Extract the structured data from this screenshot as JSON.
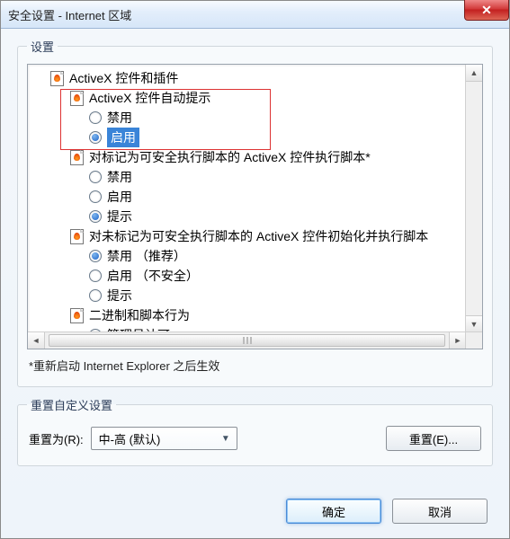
{
  "window": {
    "title": "安全设置 - Internet 区域"
  },
  "settings_group": {
    "legend": "设置"
  },
  "tree": {
    "root": {
      "label": "ActiveX 控件和插件"
    },
    "section1": {
      "label": "ActiveX 控件自动提示",
      "opt_disable": "禁用",
      "opt_enable": "启用"
    },
    "section2": {
      "label": "对标记为可安全执行脚本的 ActiveX 控件执行脚本*",
      "opt_disable": "禁用",
      "opt_enable": "启用",
      "opt_prompt": "提示"
    },
    "section3": {
      "label": "对未标记为可安全执行脚本的 ActiveX 控件初始化并执行脚本",
      "opt_disable": "禁用 （推荐）",
      "opt_enable": "启用 （不安全）",
      "opt_prompt": "提示"
    },
    "section4": {
      "label": "二进制和脚本行为",
      "opt_admin": "管理员认可"
    }
  },
  "note": "*重新启动 Internet Explorer 之后生效",
  "reset_group": {
    "legend": "重置自定义设置",
    "label": "重置为(R):",
    "dropdown_value": "中-高 (默认)",
    "reset_button": "重置(E)..."
  },
  "buttons": {
    "ok": "确定",
    "cancel": "取消"
  }
}
